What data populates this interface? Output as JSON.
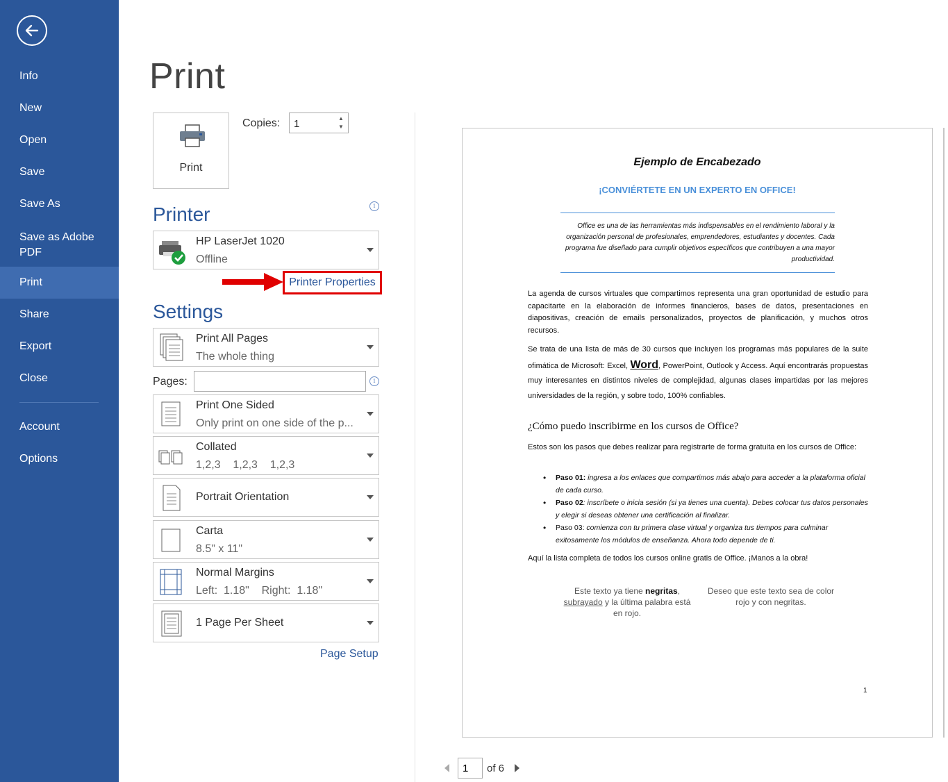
{
  "nav": {
    "items": [
      "Info",
      "New",
      "Open",
      "Save",
      "Save As",
      "Save as Adobe PDF",
      "Print",
      "Share",
      "Export",
      "Close",
      "Account",
      "Options"
    ],
    "active": "Print"
  },
  "title": "Print",
  "print_button": {
    "label": "Print"
  },
  "copies": {
    "label": "Copies:",
    "value": "1"
  },
  "printer": {
    "section_title": "Printer",
    "name": "HP LaserJet 1020",
    "status": "Offline",
    "properties_link": "Printer Properties"
  },
  "settings": {
    "section_title": "Settings",
    "print_range": {
      "main": "Print All Pages",
      "sub": "The whole thing"
    },
    "pages": {
      "label": "Pages:",
      "value": ""
    },
    "sides": {
      "main": "Print One Sided",
      "sub": "Only print on one side of the p..."
    },
    "collation": {
      "main": "Collated",
      "sub": "1,2,3    1,2,3    1,2,3"
    },
    "orientation": {
      "main": "Portrait Orientation"
    },
    "paper": {
      "main": "Carta",
      "sub": "8.5\" x 11\""
    },
    "margins": {
      "main": "Normal Margins",
      "sub": "Left:  1.18\"    Right:  1.18\""
    },
    "per_sheet": {
      "main": "1 Page Per Sheet"
    },
    "page_setup_link": "Page Setup"
  },
  "preview": {
    "heading": "Ejemplo de Encabezado",
    "subheading": "¡CONVIÉRTETE EN UN EXPERTO EN OFFICE!",
    "quote": "Office es una de las herramientas más indispensables en el rendimiento laboral y la organización personal de profesionales, emprendedores, estudiantes y docentes. Cada programa fue diseñado para cumplir objetivos específicos que contribuyen a una mayor productividad.",
    "para1": "La agenda de cursos virtuales que compartimos representa una gran oportunidad de estudio para capacitarte en la elaboración de informes financieros, bases de datos, presentaciones en diapositivas, creación de emails personalizados, proyectos de planificación, y muchos otros recursos.",
    "para2_a": "Se trata de una lista de más de 30 cursos que incluyen los programas más populares de la suite ofimática de Microsoft: Excel, ",
    "para2_word": "Word",
    "para2_b": ", PowerPoint, Outlook y Access. Aquí encontrarás propuestas muy interesantes en distintos niveles de complejidad, algunas clases impartidas por las mejores universidades de la región, y sobre todo, 100% confiables.",
    "question": "¿Cómo puedo inscribirme en los cursos de Office?",
    "steps_intro": "Estos son los pasos que debes realizar para registrarte de forma gratuita en los cursos de Office:",
    "steps": [
      {
        "label": "Paso 01:",
        "text": " ingresa a los enlaces que compartimos más abajo para acceder a la plataforma oficial de cada curso."
      },
      {
        "label": "Paso 02",
        "text": ": inscríbete o inicia sesión (si ya tienes una cuenta). Debes colocar tus datos personales y elegir si deseas obtener una certificación al finalizar."
      },
      {
        "label": "Paso 03:",
        "text": " comienza con tu primera clase virtual y organiza tus tiempos para culminar exitosamente los módulos de enseñanza. Ahora todo depende de ti."
      }
    ],
    "closing": "Aquí la lista completa de todos los cursos online gratis de Office. ¡Manos a la obra!",
    "col1_a": "Este texto ya tiene ",
    "col1_bold": "negritas",
    "col1_b": ",",
    "col1_underline": "subrayado",
    "col1_c": " y la última palabra está en rojo.",
    "col2": "Deseo que este texto sea de color rojo y con negritas.",
    "page_number": "1"
  },
  "pager": {
    "current": "1",
    "of_label": "of 6"
  },
  "colors": {
    "nav_bg": "#2b579a",
    "nav_active": "#3f6cb0",
    "accent": "#2b579a",
    "highlight_red": "#e00000"
  }
}
